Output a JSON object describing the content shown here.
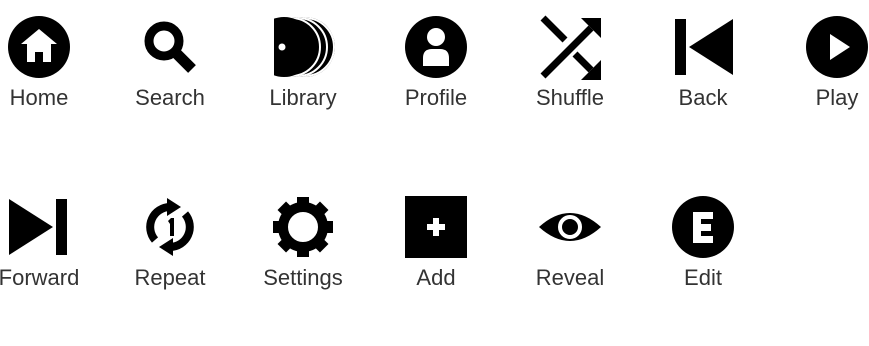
{
  "icon_color": "#000000",
  "label_color": "#333333",
  "icons": [
    {
      "name": "home-icon",
      "label": "Home"
    },
    {
      "name": "search-icon",
      "label": "Search"
    },
    {
      "name": "library-icon",
      "label": "Library"
    },
    {
      "name": "profile-icon",
      "label": "Profile"
    },
    {
      "name": "shuffle-icon",
      "label": "Shuffle"
    },
    {
      "name": "back-icon",
      "label": "Back"
    },
    {
      "name": "play-icon",
      "label": "Play"
    },
    {
      "name": "forward-icon",
      "label": "Forward"
    },
    {
      "name": "repeat-icon",
      "label": "Repeat"
    },
    {
      "name": "settings-icon",
      "label": "Settings"
    },
    {
      "name": "add-icon",
      "label": "Add"
    },
    {
      "name": "reveal-icon",
      "label": "Reveal"
    },
    {
      "name": "edit-icon",
      "label": "Edit"
    }
  ]
}
